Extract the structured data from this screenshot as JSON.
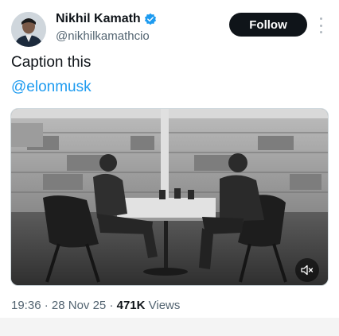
{
  "author": {
    "name": "Nikhil Kamath",
    "handle": "@nikhilkamathcio",
    "verified": true,
    "avatar_icon": "profile-photo"
  },
  "follow_button": {
    "label": "Follow"
  },
  "more_icon": "more-vertical-icon",
  "post": {
    "caption": "Caption this",
    "mention": "@elonmusk"
  },
  "media": {
    "type": "video",
    "mute_icon": "speaker-muted-icon"
  },
  "meta": {
    "time": "19:36",
    "separator": " · ",
    "date": "28 Nov 25",
    "views_count": "471K",
    "views_label": " Views"
  },
  "colors": {
    "accent": "#1d9bf0",
    "text_primary": "#0f1419",
    "text_secondary": "#536471",
    "button_bg": "#0f1419"
  }
}
